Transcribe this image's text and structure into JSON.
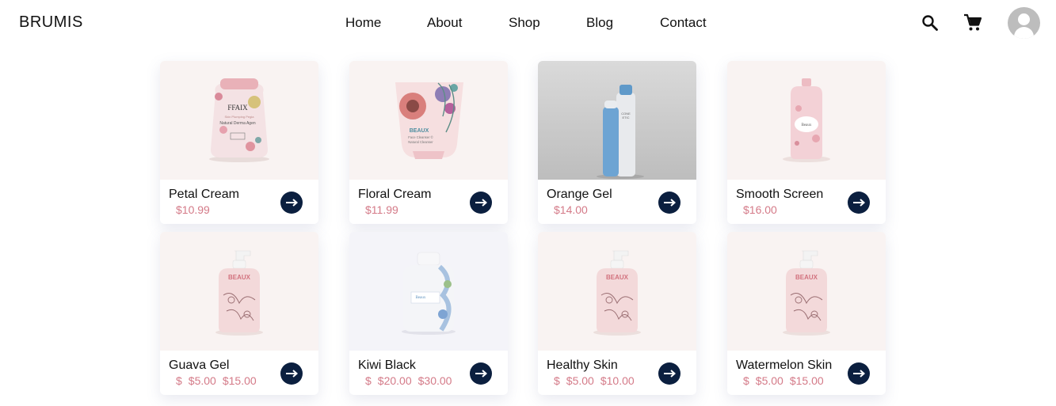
{
  "header": {
    "brand": "BRUMIS",
    "nav": [
      "Home",
      "About",
      "Shop",
      "Blog",
      "Contact"
    ],
    "icons": [
      "search-icon",
      "cart-icon",
      "account-icon"
    ]
  },
  "products": [
    {
      "name": "Petal Cream",
      "price": [
        "$10.99"
      ]
    },
    {
      "name": "Floral Cream",
      "price": [
        "$11.99"
      ]
    },
    {
      "name": "Orange Gel",
      "price": [
        "$14.00"
      ]
    },
    {
      "name": "Smooth Screen",
      "price": [
        "$16.00"
      ]
    },
    {
      "name": "Guava Gel",
      "price": [
        "$",
        "$5.00",
        "$15.00"
      ]
    },
    {
      "name": "Kiwi Black",
      "price": [
        "$",
        "$20.00",
        "$30.00"
      ]
    },
    {
      "name": "Healthy Skin",
      "price": [
        "$",
        "$5.00",
        "$10.00"
      ]
    },
    {
      "name": "Watermelon Skin",
      "price": [
        "$",
        "$5.00",
        "$15.00"
      ]
    }
  ],
  "product_labels": {
    "petal": {
      "brand": "FFAIX",
      "line1": "Skin Plumping Pegia",
      "line2": "Natural Derma Agen"
    },
    "floral": {
      "brand": "BEAUX",
      "line1": "Face Cleanser ©",
      "line2": "Natural Cleanser"
    },
    "orange": {
      "line1": "CONE",
      "line2": "ETIC"
    },
    "smooth": {
      "brand": "Beaux"
    },
    "pump": {
      "brand": "BEAUX"
    },
    "kiwi": {
      "brand": "Beaux"
    }
  },
  "colors": {
    "accent_price": "#d47a88",
    "button": "#0b1f3f",
    "card_bg": "#f9f3f2"
  }
}
